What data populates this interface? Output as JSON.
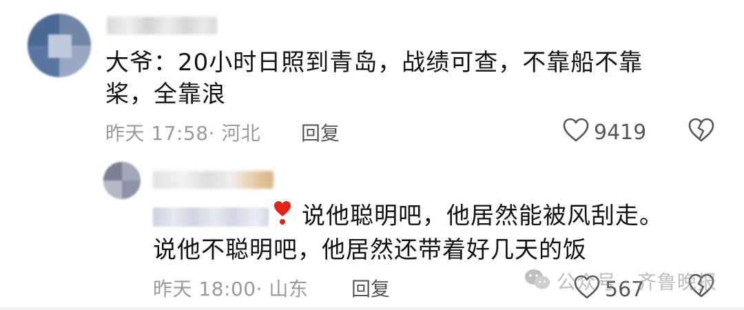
{
  "comment": {
    "text_line1": "大爷：20小时日照到青岛，战绩可查，不靠船不靠",
    "text_line2": "桨，全靠浪",
    "time": "昨天 17:58",
    "location": "· 河北",
    "reply_label": "回复",
    "likes": "9419"
  },
  "reply": {
    "text_line1": "说他聪明吧，他居然能被风刮走。",
    "text_line2": "说他不聪明吧，他居然还带着好几天的饭",
    "time": "昨天 18:00",
    "location": "· 山东",
    "reply_label": "回复",
    "likes": "567"
  },
  "watermark": {
    "text": "公众号 · 齐鲁晚报",
    "icon": "wechat-icon"
  },
  "icons": {
    "like": "heart-outline-icon",
    "dislike": "broken-heart-icon",
    "emoji": "red-heart-exclamation-icon"
  }
}
